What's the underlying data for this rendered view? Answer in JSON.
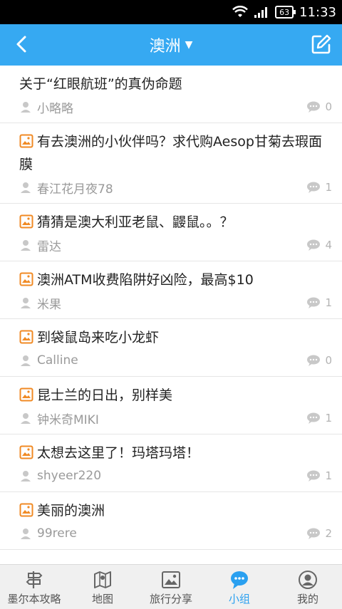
{
  "status": {
    "time": "11:33",
    "battery": "63"
  },
  "header": {
    "title": "澳洲"
  },
  "posts": [
    {
      "title": "关于“红眼航班”的真伪命题",
      "user": "小略略",
      "comments": "0",
      "has_image": false
    },
    {
      "title": "有去澳洲的小伙伴吗？求代购Aesop甘菊去瑕面膜",
      "user": "春江花月夜78",
      "comments": "1",
      "has_image": true
    },
    {
      "title": "猜猜是澳大利亚老鼠、鼹鼠。。？",
      "user": "雷达",
      "comments": "4",
      "has_image": true
    },
    {
      "title": "澳洲ATM收费陷阱好凶险，最高$10",
      "user": "米果",
      "comments": "1",
      "has_image": true
    },
    {
      "title": "到袋鼠岛来吃小龙虾",
      "user": "Calline",
      "comments": "0",
      "has_image": true
    },
    {
      "title": "昆士兰的日出，别样美",
      "user": "钟米奇MIKI",
      "comments": "1",
      "has_image": true
    },
    {
      "title": "太想去这里了！玛塔玛塔！",
      "user": "shyeer220",
      "comments": "1",
      "has_image": true
    },
    {
      "title": "美丽的澳洲",
      "user": "99rere",
      "comments": "2",
      "has_image": true
    }
  ],
  "tabs": [
    {
      "label": "墨尔本攻略",
      "icon": "signpost-icon",
      "active": false
    },
    {
      "label": "地图",
      "icon": "map-icon",
      "active": false
    },
    {
      "label": "旅行分享",
      "icon": "photo-icon",
      "active": false
    },
    {
      "label": "小组",
      "icon": "chat-bubble-icon",
      "active": true
    },
    {
      "label": "我的",
      "icon": "profile-icon",
      "active": false
    }
  ],
  "colors": {
    "header_bg": "#36a9f2",
    "accent": "#2aa0f0",
    "image_icon": "#f08a24"
  }
}
